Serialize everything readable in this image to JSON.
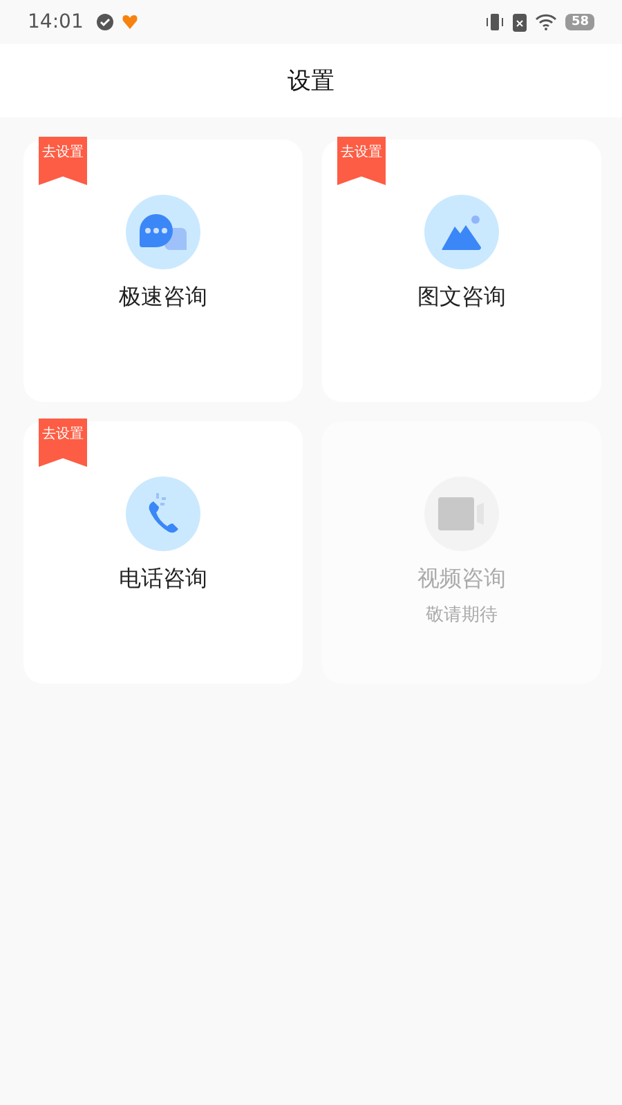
{
  "status_bar": {
    "time": "14:01",
    "battery": "58"
  },
  "header": {
    "title": "设置"
  },
  "services": [
    {
      "kind": "chat",
      "title": "极速咨询",
      "badge": "去设置",
      "disabled": false
    },
    {
      "kind": "image",
      "title": "图文咨询",
      "badge": "去设置",
      "disabled": false
    },
    {
      "kind": "phone",
      "title": "电话咨询",
      "badge": "去设置",
      "disabled": false
    },
    {
      "kind": "video",
      "title": "视频咨询",
      "subtitle": "敬请期待",
      "disabled": true
    }
  ]
}
